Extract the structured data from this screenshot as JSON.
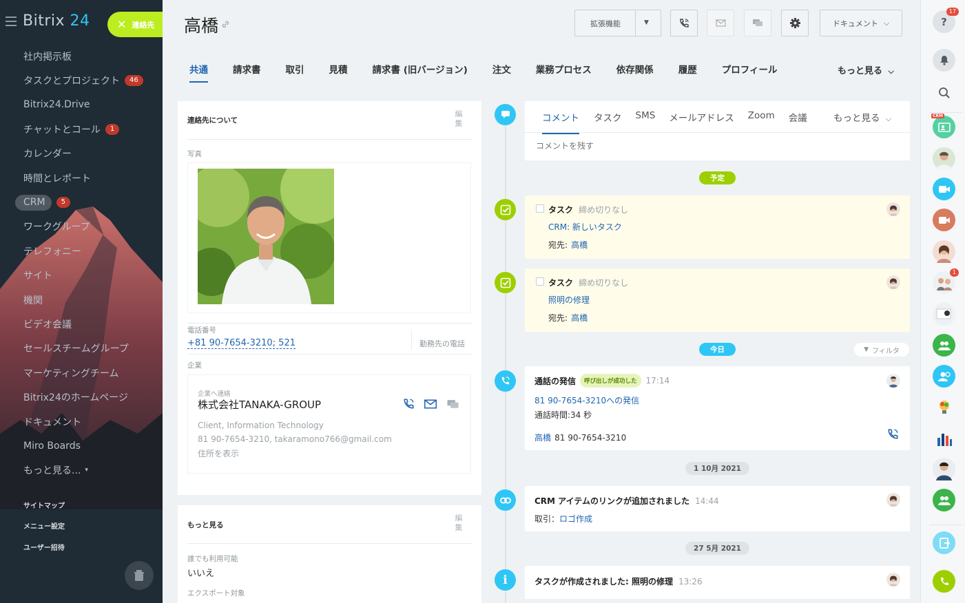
{
  "sidebar": {
    "logo_main": "Bitrix",
    "logo_num": "24",
    "contact_button": "連絡先",
    "items": [
      {
        "label": "社内掲示板"
      },
      {
        "label": "タスクとプロジェクト",
        "badge": "46"
      },
      {
        "label": "Bitrix24.Drive"
      },
      {
        "label": "チャットとコール",
        "badge": "1"
      },
      {
        "label": "カレンダー"
      },
      {
        "label": "時間とレポート"
      },
      {
        "label": "CRM",
        "badge": "5"
      },
      {
        "label": "ワークグループ"
      },
      {
        "label": "テレフォニー"
      },
      {
        "label": "サイト"
      },
      {
        "label": "機関"
      },
      {
        "label": "ビデオ会議"
      },
      {
        "label": "セールスチームグループ"
      },
      {
        "label": "マーケティングチーム"
      },
      {
        "label": "Bitrix24のホームページ"
      },
      {
        "label": "ドキュメント"
      },
      {
        "label": "Miro Boards"
      },
      {
        "label": "もっと見る..."
      }
    ],
    "bottom": [
      "サイトマップ",
      "メニュー設定",
      "ユーザー招待"
    ]
  },
  "header": {
    "title": "高橋",
    "ext_button": "拡張機能",
    "doc_button": "ドキュメント",
    "tabs": [
      "共通",
      "請求書",
      "取引",
      "見積",
      "請求書 (旧バージョン)",
      "注文",
      "業務プロセス",
      "依存関係",
      "履歴",
      "プロフィール"
    ],
    "more": "もっと見る"
  },
  "about": {
    "heading": "連絡先について",
    "edit": "編集",
    "photo_label": "写真",
    "phone_label": "電話番号",
    "phone": "+81 90-7654-3210; 521",
    "phone_type": "勤務先の電話",
    "company_label": "企業",
    "company_sub": "企業へ連絡",
    "company_name": "株式会社TANAKA-GROUP",
    "company_type": "Client, Information Technology",
    "company_contact": "81 90-7654-3210, takaramono766@gmail.com",
    "company_address": "住所を表示"
  },
  "more_card": {
    "heading": "もっと見る",
    "edit": "編集",
    "avail_label": "誰でも利用可能",
    "avail_value": "いいえ",
    "export_label": "エクスポート対象"
  },
  "timeline": {
    "tabs": [
      "コメント",
      "タスク",
      "SMS",
      "メールアドレス",
      "Zoom",
      "会議"
    ],
    "more": "もっと見る",
    "comment_placeholder": "コメントを残す",
    "planned": "予定",
    "today": "今日",
    "filter": "フィルタ",
    "tasks": [
      {
        "title": "タスク",
        "deadline": "締め切りなし",
        "name": "CRM: 新しいタスク",
        "to_label": "宛先:",
        "to": "高橋"
      },
      {
        "title": "タスク",
        "deadline": "締め切りなし",
        "name": "照明の修理",
        "to_label": "宛先:",
        "to": "高橋"
      }
    ],
    "call": {
      "title": "通話の発信",
      "status": "呼び出しが成功した",
      "time": "17:14",
      "link": "81 90-7654-3210への発信",
      "duration": "通話時間:34 秒",
      "who": "高橋",
      "number": "81 90-7654-3210"
    },
    "date1": "1 10月 2021",
    "link_item": {
      "title": "CRM アイテムのリンクが追加されました",
      "time": "14:44",
      "prefix": "取引：",
      "link": "ロゴ作成"
    },
    "date2": "27 5月 2021",
    "task_created": {
      "title": "タスクが作成されました: 照明の修理",
      "time": "13:26"
    }
  },
  "rightbar": {
    "help_badge": "17",
    "user_badge": "1"
  }
}
